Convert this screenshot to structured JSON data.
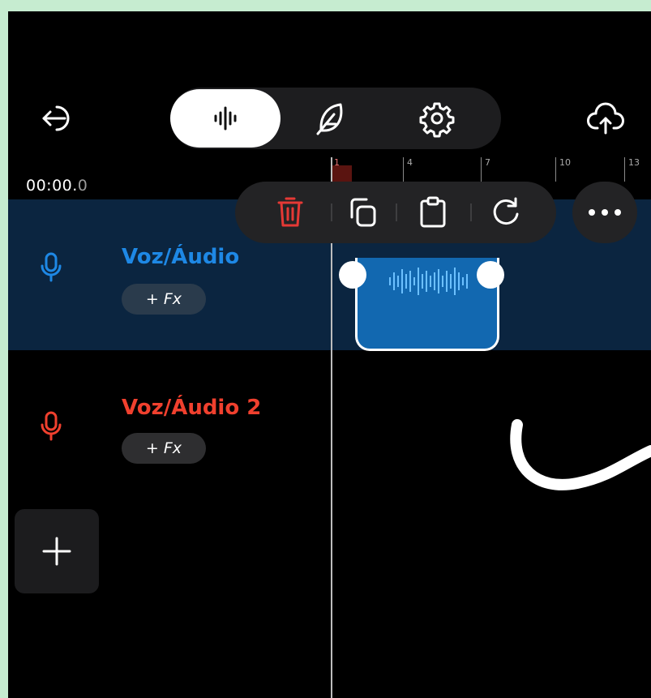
{
  "toolbar": {
    "back_icon": "back-arrow-icon",
    "mode_tabs": [
      {
        "icon": "waveform-icon",
        "active": true
      },
      {
        "icon": "feather-icon",
        "active": false
      },
      {
        "icon": "gear-icon",
        "active": false
      }
    ],
    "upload_icon": "cloud-upload-icon"
  },
  "ruler": {
    "time_main": "00:00.",
    "time_frac": "0",
    "marks": [
      "1",
      "4",
      "7",
      "10",
      "13"
    ]
  },
  "context_menu": {
    "items": [
      "trash-icon",
      "copy-icon",
      "paste-icon",
      "redo-icon"
    ],
    "more_icon": "more-horizontal-icon"
  },
  "tracks": [
    {
      "name": "Voz/Áudio",
      "fx_label": "+ Fx",
      "color": "#1e88e5",
      "selected": true
    },
    {
      "name": "Voz/Áudio 2",
      "fx_label": "+ Fx",
      "color": "#f0402e",
      "selected": false
    }
  ],
  "add_track_icon": "plus-icon",
  "colors": {
    "frame": "#c6ecd0",
    "clip": "#1268b0",
    "selected_track_bg": "#0b2540",
    "delete_red": "#e53935"
  }
}
